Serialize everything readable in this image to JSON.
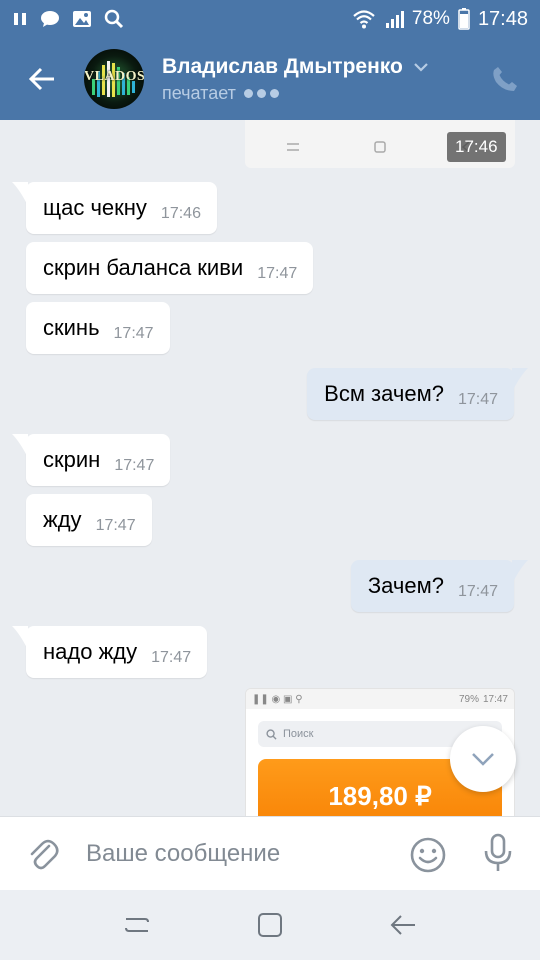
{
  "status_bar": {
    "battery": "78%",
    "time": "17:48",
    "icons": [
      "pause-icon",
      "message-icon",
      "gallery-icon",
      "search-icon",
      "wifi-icon",
      "signal-icon",
      "battery-icon"
    ]
  },
  "header": {
    "contact_name": "Владислав Дмытренко",
    "status": "печатает",
    "avatar_text": "VLADOS",
    "accent_color": "#4a76a8"
  },
  "image_top": {
    "time": "17:46"
  },
  "messages": [
    {
      "direction": "in",
      "text": "щас чекну",
      "time": "17:46"
    },
    {
      "direction": "in",
      "text": "скрин баланса киви",
      "time": "17:47"
    },
    {
      "direction": "in",
      "text": "скинь",
      "time": "17:47"
    },
    {
      "direction": "out",
      "text": "Всм зачем?",
      "time": "17:47"
    },
    {
      "direction": "in",
      "text": "скрин",
      "time": "17:47"
    },
    {
      "direction": "in",
      "text": "жду",
      "time": "17:47"
    },
    {
      "direction": "out",
      "text": "Зачем?",
      "time": "17:47"
    },
    {
      "direction": "in",
      "text": "надо жду",
      "time": "17:47"
    }
  ],
  "image_bottom": {
    "status_battery": "79%",
    "status_time": "17:47",
    "search_placeholder": "Поиск",
    "balance": "189,80 ₽",
    "balance_color": "#f57c00"
  },
  "composer": {
    "placeholder": "Ваше сообщение",
    "value": ""
  }
}
